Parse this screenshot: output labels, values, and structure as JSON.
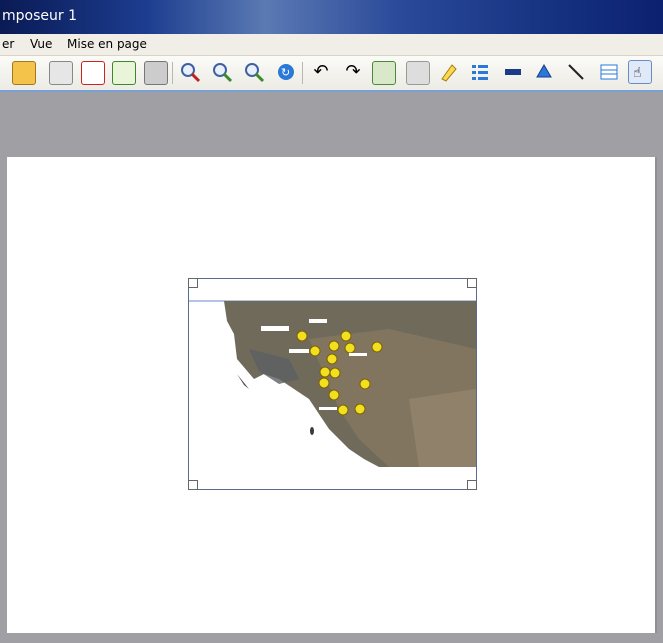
{
  "window": {
    "title": "mposeur 1"
  },
  "menu": [
    "er",
    "Vue",
    "Mise en page"
  ],
  "toolbar": {
    "icons": [
      "save-icon",
      "export-image-icon",
      "export-pdf-icon",
      "export-svg-icon",
      "print-icon",
      "zoom-full-icon",
      "zoom-in-icon",
      "zoom-out-icon",
      "refresh-icon",
      "undo-icon",
      "redo-icon",
      "add-map-icon",
      "add-image-icon",
      "add-label-icon",
      "add-legend-icon",
      "add-scalebar-icon",
      "add-shape-icon",
      "add-arrow-icon",
      "add-table-icon",
      "select-move-icon"
    ]
  },
  "map_labels": [
    "Sidi Bel",
    "Kef Oumm",
    "Aïn Fakroun"
  ]
}
